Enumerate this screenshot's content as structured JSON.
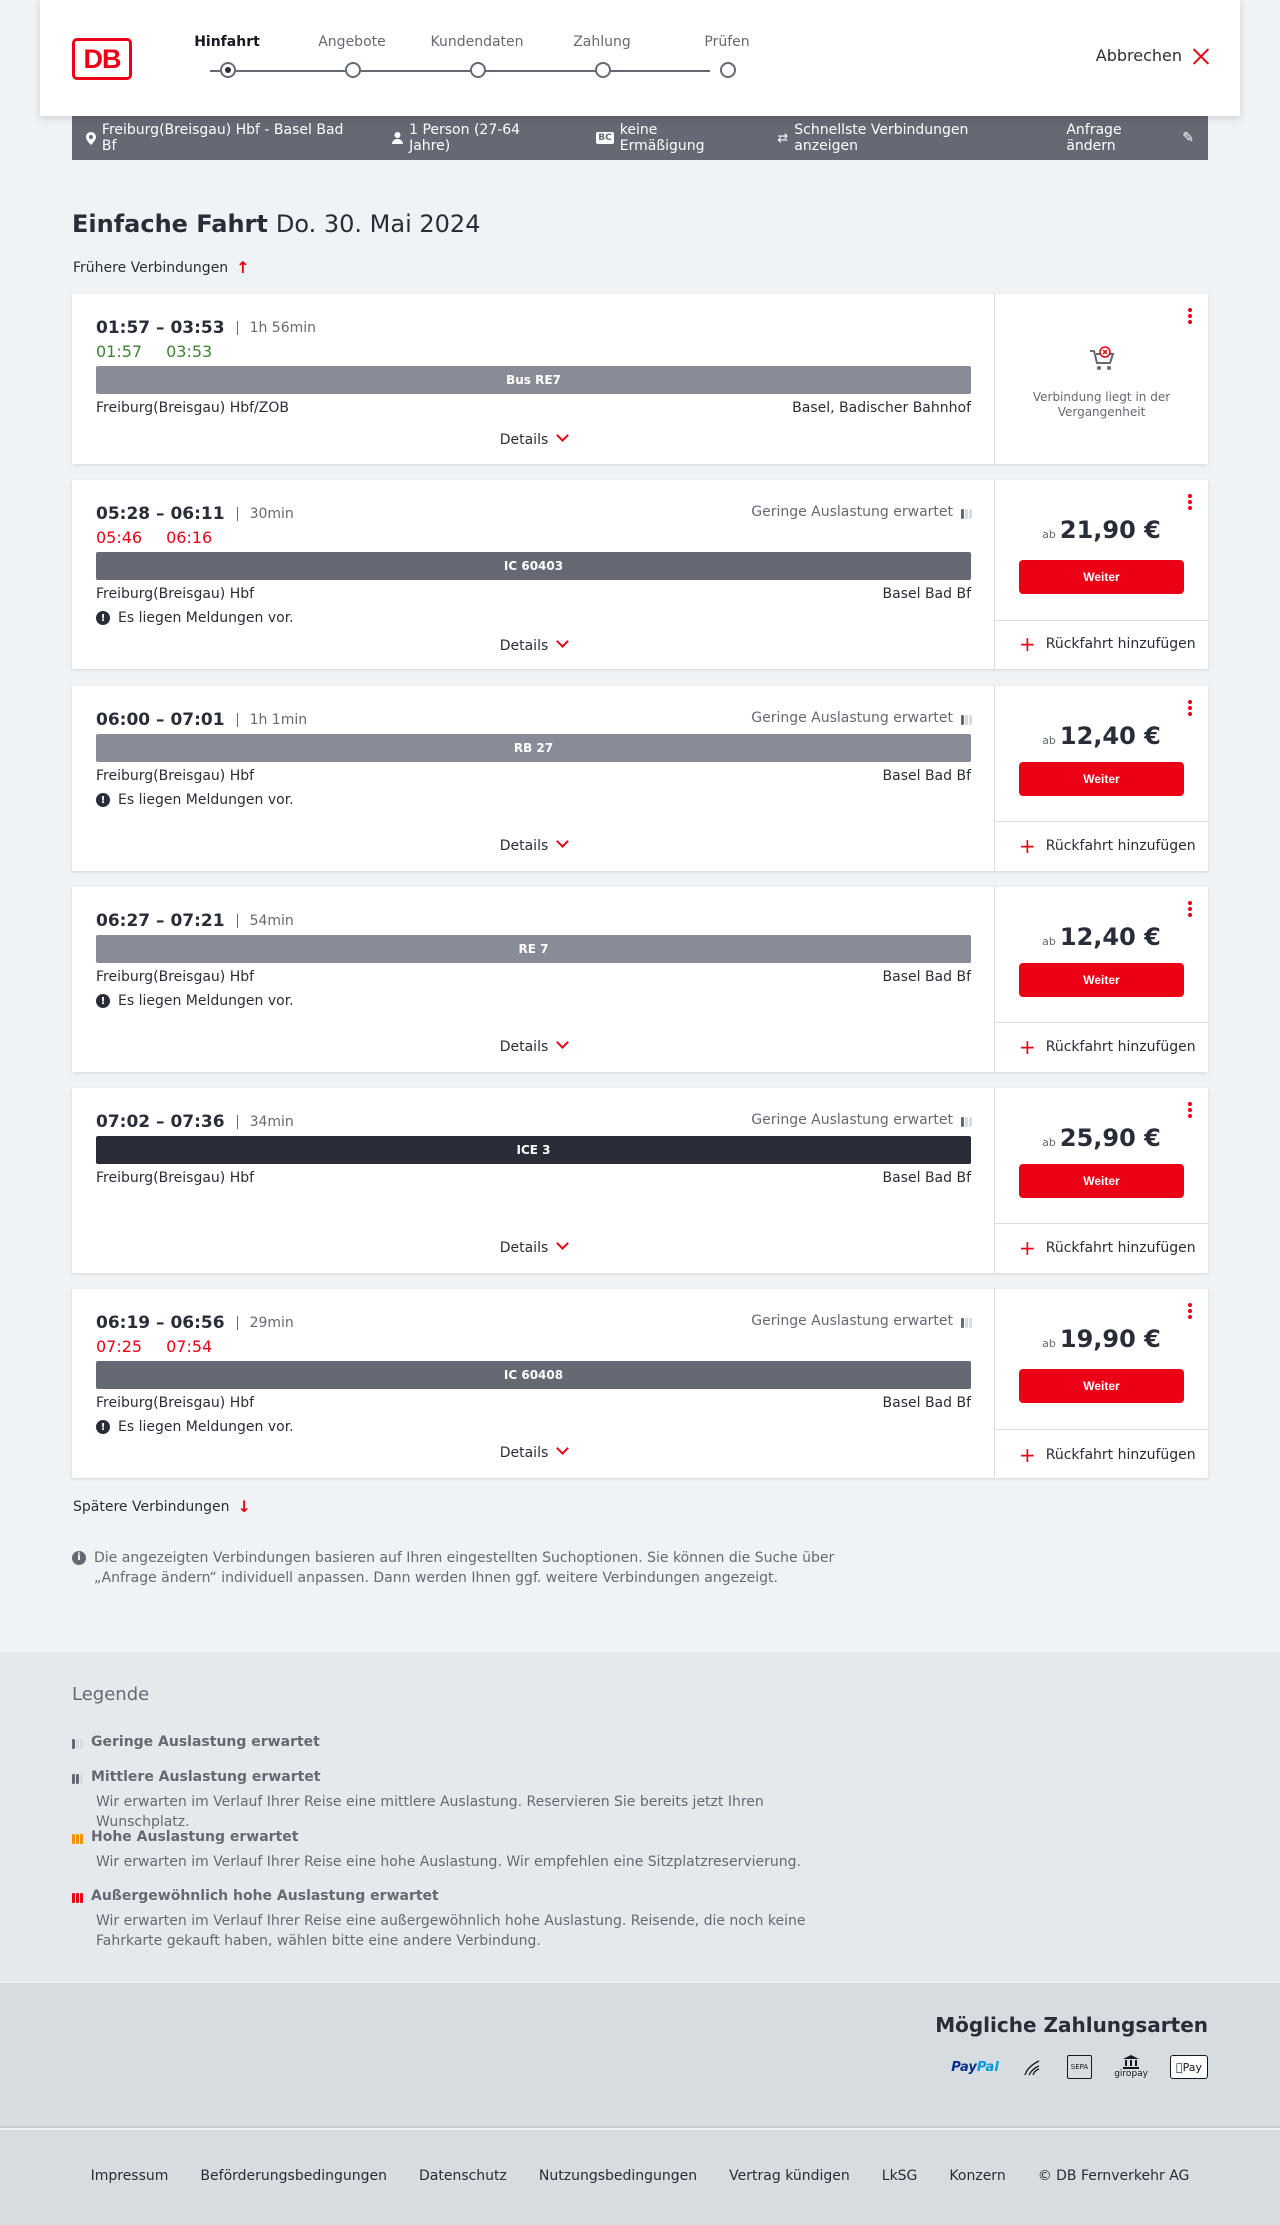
{
  "header": {
    "logo": "DB",
    "steps": [
      "Hinfahrt",
      "Angebote",
      "Kundendaten",
      "Zahlung",
      "Prüfen"
    ],
    "cancel_label": "Abbrechen"
  },
  "summary": {
    "route": "Freiburg(Breisgau) Hbf - Basel Bad Bf",
    "passengers": "1 Person (27-64 Jahre)",
    "discount": "keine Ermäßigung",
    "fastest": "Schnellste Verbindungen anzeigen",
    "edit": "Anfrage ändern"
  },
  "title": {
    "bold": "Einfache Fahrt",
    "date": "Do. 30. Mai 2024"
  },
  "earlier": "Frühere Verbindungen",
  "later": "Spätere Verbindungen",
  "labels": {
    "details": "Details",
    "weiter": "Weiter",
    "ab": "ab",
    "return_add": "Rückfahrt hinzufügen",
    "notice": "Es liegen Meldungen vor.",
    "utilization": "Geringe Auslastung erwartet",
    "past": "Verbindung liegt in der Vergangenheit"
  },
  "connections": [
    {
      "time": "01:57 – 03:53",
      "duration": "1h 56min",
      "rt_dep": "01:57",
      "rt_arr": "03:53",
      "train": "Bus RE7",
      "from": "Freiburg(Breisgau) Hbf/ZOB",
      "to": "Basel, Badischer Bahnhof"
    },
    {
      "time": "05:28 – 06:11",
      "duration": "30min",
      "rt_dep": "05:46",
      "rt_arr": "06:16",
      "train": "IC 60403",
      "from": "Freiburg(Breisgau) Hbf",
      "to": "Basel Bad Bf",
      "price": "21,90 €"
    },
    {
      "time": "06:00 – 07:01",
      "duration": "1h 1min",
      "train": "RB 27",
      "from": "Freiburg(Breisgau) Hbf",
      "to": "Basel Bad Bf",
      "price": "12,40 €"
    },
    {
      "time": "06:27 – 07:21",
      "duration": "54min",
      "train": "RE 7",
      "from": "Freiburg(Breisgau) Hbf",
      "to": "Basel Bad Bf",
      "price": "12,40 €"
    },
    {
      "time": "07:02 – 07:36",
      "duration": "34min",
      "train": "ICE 3",
      "from": "Freiburg(Breisgau) Hbf",
      "to": "Basel Bad Bf",
      "price": "25,90 €"
    },
    {
      "time": "06:19 – 06:56",
      "duration": "29min",
      "rt_dep": "07:25",
      "rt_arr": "07:54",
      "train": "IC 60408",
      "from": "Freiburg(Breisgau) Hbf",
      "to": "Basel Bad Bf",
      "price": "19,90 €"
    }
  ],
  "info_text": "Die angezeigten Verbindungen basieren auf Ihren eingestellten Suchoptionen. Sie können die Suche über „Anfrage ändern“ individuell anpassen. Dann werden Ihnen ggf. weitere Verbindungen angezeigt.",
  "legend": {
    "title": "Legende",
    "items": [
      {
        "head": "Geringe Auslastung erwartet",
        "desc": ""
      },
      {
        "head": "Mittlere Auslastung erwartet",
        "desc": "Wir erwarten im Verlauf Ihrer Reise eine mittlere Auslastung. Reservieren Sie bereits jetzt Ihren Wunschplatz."
      },
      {
        "head": "Hohe Auslastung erwartet",
        "desc": "Wir erwarten im Verlauf Ihrer Reise eine hohe Auslastung. Wir empfehlen eine Sitzplatzreservierung."
      },
      {
        "head": "Außergewöhnlich hohe Auslastung erwartet",
        "desc": "Wir erwarten im Verlauf Ihrer Reise eine außergewöhnlich hohe Auslastung. Reisende, die noch keine Fahrkarte gekauft haben, wählen bitte eine andere Verbindung."
      }
    ]
  },
  "payment": {
    "title": "Mögliche Zahlungsarten",
    "paypal_a": "Pay",
    "paypal_b": "Pal",
    "sepa": "SEPA",
    "giropay": "giropay",
    "applepay": "Pay"
  },
  "footer": [
    "Impressum",
    "Beförderungsbedingungen",
    "Datenschutz",
    "Nutzungsbedingungen",
    "Vertrag kündigen",
    "LkSG",
    "Konzern",
    "© DB Fernverkehr AG"
  ],
  "colors": {
    "brand": "#ec0016",
    "realtime_ok": "#408335",
    "realtime_late": "#ec0016",
    "summary_bar": "#646973"
  }
}
